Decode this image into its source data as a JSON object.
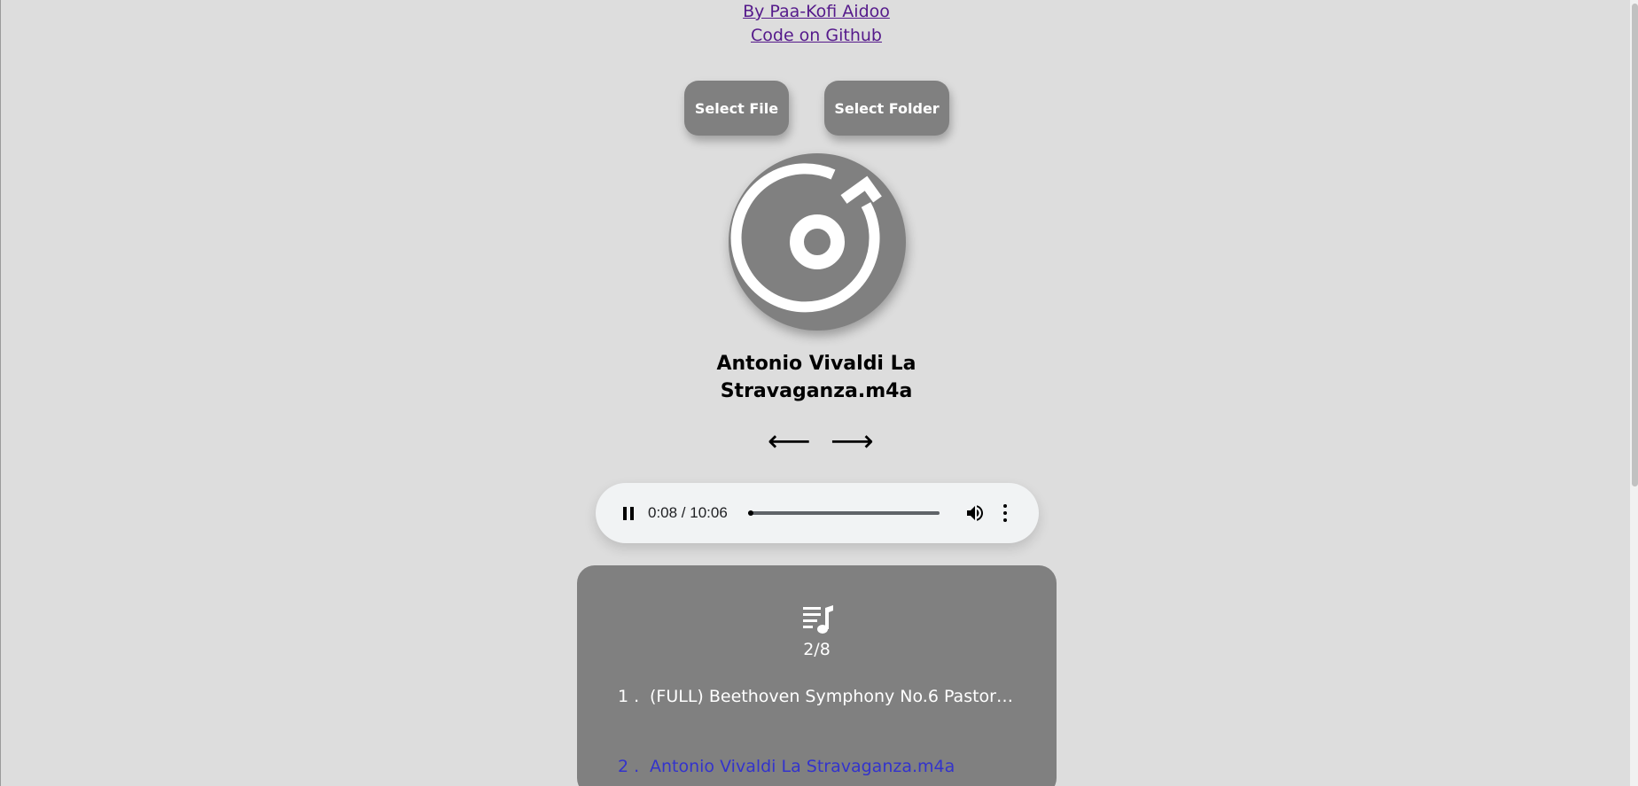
{
  "credits": {
    "author_link": "By Paa-Kofi Aidoo",
    "github_link": "Code on Github"
  },
  "buttons": {
    "select_file": "Select File",
    "select_folder": "Select Folder"
  },
  "now_playing": {
    "title": "Antonio Vivaldi La Stravaganza.m4a",
    "prev_arrow": "⟵",
    "next_arrow": "⟶"
  },
  "player": {
    "state": "playing",
    "time": "0:08 / 10:06",
    "progress_fraction": 0.013
  },
  "playlist": {
    "count": "2/8",
    "items": [
      {
        "num": "1 .",
        "name": "(FULL) Beethoven Symphony No.6 Pastorale ..."
      },
      {
        "num": "2 .",
        "name": "Antonio Vivaldi La Stravaganza.m4a"
      }
    ],
    "active_index": 2
  },
  "colors": {
    "background": "#dddddd",
    "panel_gray": "#808080",
    "active_item": "#3333cc",
    "link_visited": "#551a8b"
  }
}
